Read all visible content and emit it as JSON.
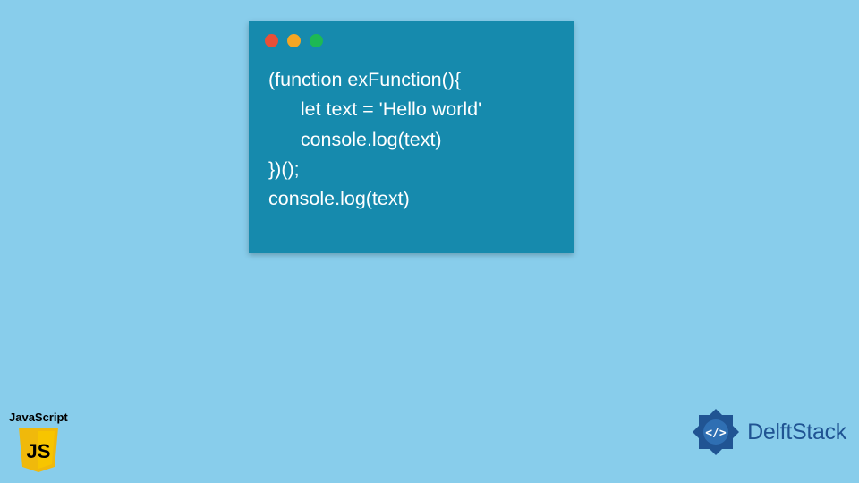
{
  "code": {
    "line1": "(function exFunction(){",
    "line2": "      let text = 'Hello world'",
    "line3": "      console.log(text)",
    "line4": "})();",
    "line5": "console.log(text)"
  },
  "js_badge": {
    "label": "JavaScript",
    "shield_text": "JS"
  },
  "brand": {
    "name": "DelftStack"
  },
  "traffic": {
    "red": "close-icon",
    "yellow": "minimize-icon",
    "green": "maximize-icon"
  }
}
